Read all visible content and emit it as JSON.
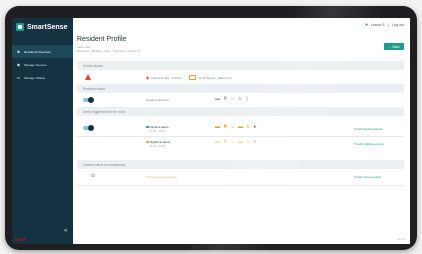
{
  "app": {
    "name": "SmartSense"
  },
  "topbar": {
    "user": "Ursula S.",
    "logout": "Log out"
  },
  "sidebar": {
    "items": [
      {
        "label": "Residents Overview",
        "active": true
      },
      {
        "label": "Manage Sensors"
      },
      {
        "label": "Manage Tablets"
      }
    ],
    "collapse": "«",
    "footer": "BOXY"
  },
  "page": {
    "title": "Resident Profile",
    "subtitle": "Irene Hart",
    "breadcrumb": "Residents · Building · Floor · Flat Room · Room 14",
    "back_label": "← Back"
  },
  "sections": {
    "issues": "Unlock Issues",
    "status": "Resident status",
    "triggers": "Alerts triggered from the room",
    "camera": "Camera views on smartphone"
  },
  "issues": {
    "sensor": "Critical Sensor · Inactive",
    "battery": "Circuit Sensor · Battery low"
  },
  "status": {
    "label": "Resident detected"
  },
  "alarms": [
    {
      "name": "Daytime alerts",
      "time": "07:00 – 21:00",
      "dot": "#3b7ddd",
      "link": "Edit daytime alerts"
    },
    {
      "name": "Nighttime alerts",
      "time": "21:00 – 07:00",
      "dot": "#e8a12f",
      "link": "Edit nighttime alerts"
    }
  ],
  "camera": {
    "text": "Resident camera module",
    "link": "Edit camera alerts"
  },
  "version": "v3.0.1"
}
